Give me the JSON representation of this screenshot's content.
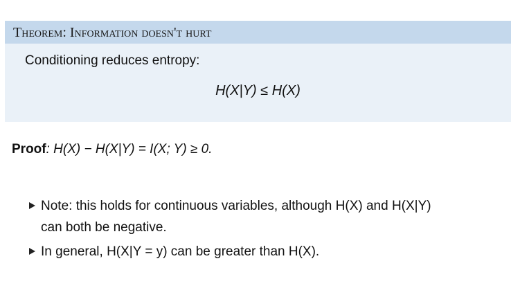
{
  "theorem": {
    "title": "Theorem: Information doesn't hurt",
    "statement": "Conditioning reduces entropy:",
    "equation": "H(X|Y) ≤ H(X)"
  },
  "proof": {
    "label": "Proof",
    "text": ": H(X) − H(X|Y) = I(X; Y) ≥ 0."
  },
  "bullets": [
    {
      "line1": "Note: this holds for continuous variables, although H(X) and H(X|Y)",
      "line2": "can both be negative."
    },
    {
      "line1": "In general, H(X|Y = y) can be greater than H(X)."
    }
  ]
}
